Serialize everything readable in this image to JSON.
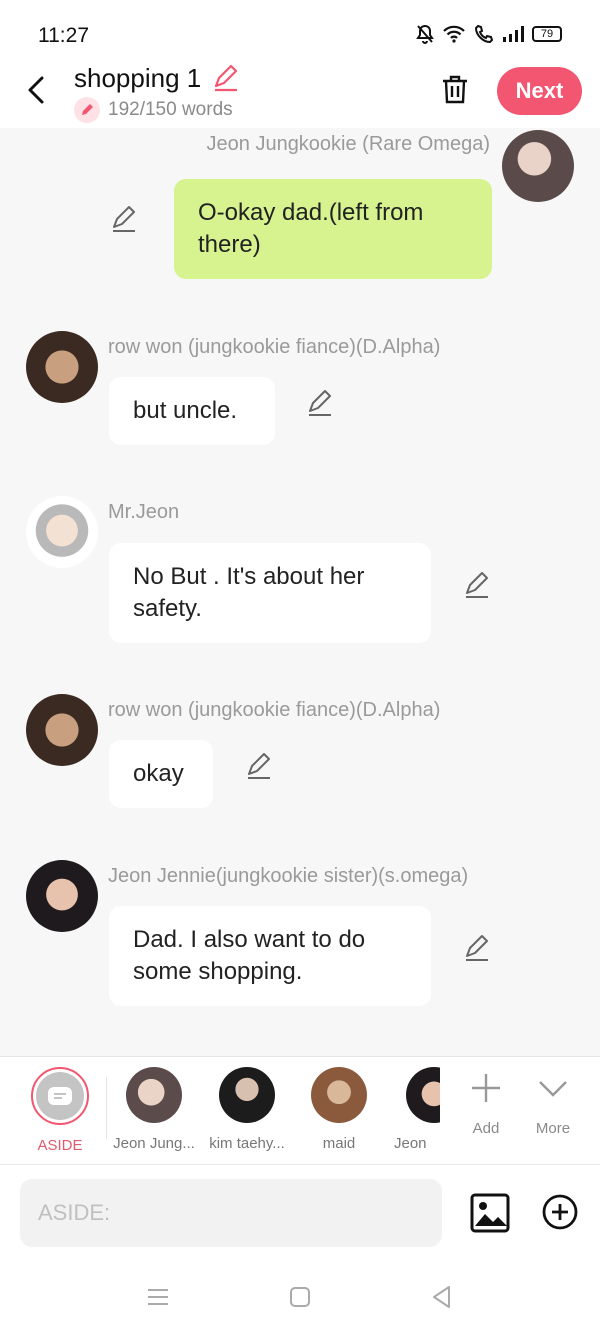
{
  "status_bar": {
    "time": "11:27",
    "battery": "79"
  },
  "header": {
    "title": "shopping 1",
    "word_count": "192/150 words",
    "next_label": "Next"
  },
  "messages": [
    {
      "speaker": "Jeon Jungkookie (Rare Omega)",
      "text": "O-okay dad.(left from there)",
      "side": "right"
    },
    {
      "speaker": "row won (jungkookie fiance)(D.Alpha)",
      "text": "but uncle.",
      "side": "left"
    },
    {
      "speaker": "Mr.Jeon",
      "text": "No But . It's about her safety.",
      "side": "left"
    },
    {
      "speaker": "row won (jungkookie fiance)(D.Alpha)",
      "text": "okay",
      "side": "left"
    },
    {
      "speaker": "Jeon Jennie(jungkookie sister)(s.omega)",
      "text": "Dad. I also want to do some shopping.",
      "side": "left"
    }
  ],
  "cast": [
    {
      "label": "ASIDE",
      "selected": true
    },
    {
      "label": "Jeon Jung..."
    },
    {
      "label": "kim taehy..."
    },
    {
      "label": "maid"
    },
    {
      "label": "Jeon"
    }
  ],
  "tools": {
    "add_label": "Add",
    "more_label": "More"
  },
  "input": {
    "placeholder": "ASIDE:"
  },
  "colors": {
    "accent": "#f35670",
    "my_bubble": "#d7f38f",
    "background": "#f7f7f7"
  }
}
